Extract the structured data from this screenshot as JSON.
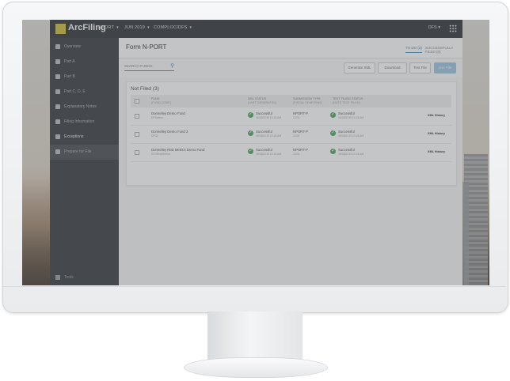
{
  "app": {
    "brand": "ArcFiling",
    "topnav": [
      {
        "label": "NPORT"
      },
      {
        "label": "JUN 2019"
      },
      {
        "label": "COMPLOCIDFS"
      }
    ],
    "user": "DFS"
  },
  "sidebar": {
    "items": [
      {
        "label": "Overview"
      },
      {
        "label": "Part A"
      },
      {
        "label": "Part B"
      },
      {
        "label": "Part C, D, E"
      },
      {
        "label": "Explanatory Notes"
      },
      {
        "label": "Filing Information"
      },
      {
        "label": "Exceptions"
      },
      {
        "label": "Prepare for File"
      }
    ],
    "bottom_label": "Tools"
  },
  "page": {
    "title": "Form N-PORT",
    "tabs": [
      "TO DO (3)",
      "SUCCESSFULLY FILED (0)"
    ]
  },
  "toolbar": {
    "search_placeholder": "SEARCH FUNDS",
    "buttons": [
      "Generate XML",
      "Download",
      "Test File",
      "Live File"
    ]
  },
  "table": {
    "title": "Not Filed (3)",
    "headers": [
      {
        "main": "FUND",
        "sub": "(FUND CODE)"
      },
      {
        "main": "XML STATUS",
        "sub": "(LAST GENERATED)"
      },
      {
        "main": "SUBMISSION TYPE",
        "sub": "(FISCAL YEAR END)"
      },
      {
        "main": "TEST FILING STATUS",
        "sub": "(DATE TEST FILED)"
      }
    ],
    "rows": [
      {
        "fund": "Donnelley Demo Fund",
        "code": "DFSdemo",
        "xml_status": "Successful",
        "xml_date": "08/28/2019 10:24 AM",
        "type": "NPORT-P",
        "fye": "12/31",
        "test_status": "Successful",
        "test_date": "08/28/2019 10:24 AM",
        "action": "XML History"
      },
      {
        "fund": "Donnelley Demo Fund 2",
        "code": "DFS2",
        "xml_status": "Successful",
        "xml_date": "08/28/2019 10:24 AM",
        "type": "NPORT-P",
        "fye": "12/31",
        "test_status": "Successful",
        "test_date": "08/28/2019 10:24 AM",
        "action": "XML History"
      },
      {
        "fund": "Donnelley Risk Metrics Demo Fund",
        "code": "DFSRiskMetrics",
        "xml_status": "Successful",
        "xml_date": "08/28/2019 10:24 AM",
        "type": "NPORT-P",
        "fye": "12/31",
        "test_status": "Successful",
        "test_date": "08/28/2019 10:24 AM",
        "action": "XML History"
      }
    ]
  },
  "colors": {
    "topbar": "#3f4247",
    "sidebar": "#46494e",
    "accent": "#4a8fc4",
    "success": "#5aa56a",
    "logo": "#c9b94e"
  }
}
